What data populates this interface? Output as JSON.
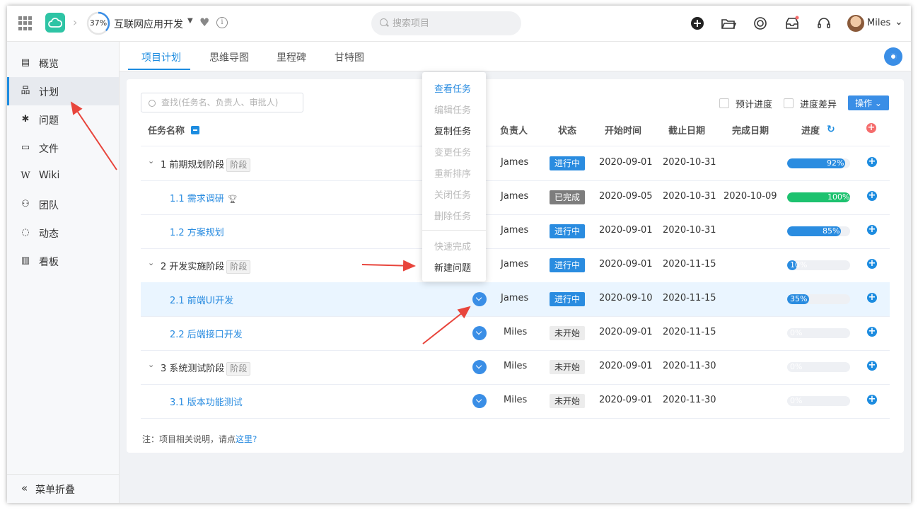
{
  "header": {
    "progress": "37%",
    "progress_value": 37,
    "project_title": "互联网应用开发",
    "search_placeholder": "搜索项目",
    "user_name": "Miles"
  },
  "sidebar": {
    "items": [
      {
        "label": "概览",
        "icon": "overview-icon"
      },
      {
        "label": "计划",
        "icon": "plan-icon"
      },
      {
        "label": "问题",
        "icon": "bug-icon"
      },
      {
        "label": "文件",
        "icon": "folder-icon"
      },
      {
        "label": "Wiki",
        "icon": "wiki-icon"
      },
      {
        "label": "团队",
        "icon": "team-icon"
      },
      {
        "label": "动态",
        "icon": "activity-icon"
      },
      {
        "label": "看板",
        "icon": "chart-icon"
      }
    ],
    "collapse_label": "菜单折叠"
  },
  "tabs": [
    "项目计划",
    "思维导图",
    "里程碑",
    "甘特图"
  ],
  "toolbar": {
    "search_placeholder": "查找(任务名、负责人、审批人)",
    "planned_progress": "预计进度",
    "progress_diff": "进度差异",
    "op_label": "操作 ⌄"
  },
  "table": {
    "headers": {
      "name": "任务名称",
      "owner": "负责人",
      "status": "状态",
      "start": "开始时间",
      "due": "截止日期",
      "done": "完成日期",
      "progress": "进度"
    },
    "stage_tag": "阶段",
    "rows": [
      {
        "name": "1 前期规划阶段",
        "stage": true,
        "owner": "James",
        "status": "进行中",
        "status_type": "doing",
        "start": "2020-09-01",
        "due": "2020-10-31",
        "done": "",
        "progress": 92,
        "progress_label": "92%"
      },
      {
        "name": "1.1 需求调研",
        "trophy": true,
        "owner": "James",
        "status": "已完成",
        "status_type": "done",
        "start": "2020-09-05",
        "due": "2020-10-31",
        "done": "2020-10-09",
        "progress": 100,
        "progress_label": "100%"
      },
      {
        "name": "1.2 方案规划",
        "owner": "James",
        "status": "进行中",
        "status_type": "doing",
        "start": "2020-09-01",
        "due": "2020-10-31",
        "done": "",
        "progress": 85,
        "progress_label": "85%"
      },
      {
        "name": "2 开发实施阶段",
        "stage": true,
        "owner": "James",
        "status": "进行中",
        "status_type": "doing",
        "start": "2020-09-01",
        "due": "2020-11-15",
        "done": "",
        "progress": 10,
        "progress_label": "10%"
      },
      {
        "name": "2.1 前端UI开发",
        "owner": "James",
        "status": "进行中",
        "status_type": "doing",
        "start": "2020-09-10",
        "due": "2020-11-15",
        "done": "",
        "progress": 35,
        "progress_label": "35%"
      },
      {
        "name": "2.2 后端接口开发",
        "owner": "Miles",
        "status": "未开始",
        "status_type": "todo",
        "start": "2020-09-01",
        "due": "2020-11-15",
        "done": "",
        "progress": 0,
        "progress_label": "0%"
      },
      {
        "name": "3 系统测试阶段",
        "stage": true,
        "owner": "Miles",
        "status": "未开始",
        "status_type": "todo",
        "start": "2020-09-01",
        "due": "2020-11-30",
        "done": "",
        "progress": 0,
        "progress_label": "0%"
      },
      {
        "name": "3.1 版本功能测试",
        "owner": "Miles",
        "status": "未开始",
        "status_type": "todo",
        "start": "2020-09-01",
        "due": "2020-11-30",
        "done": "",
        "progress": 0,
        "progress_label": "0%"
      }
    ]
  },
  "note": {
    "text": "注：项目相关说明，请点",
    "link": "这里?"
  },
  "menu": {
    "items": [
      {
        "label": "查看任务",
        "state": "active"
      },
      {
        "label": "编辑任务",
        "state": "disabled"
      },
      {
        "label": "复制任务",
        "state": "normal"
      },
      {
        "label": "变更任务",
        "state": "disabled"
      },
      {
        "label": "重新排序",
        "state": "disabled"
      },
      {
        "label": "关闭任务",
        "state": "disabled"
      },
      {
        "label": "删除任务",
        "state": "disabled"
      },
      {
        "label": "快速完成",
        "state": "disabled"
      },
      {
        "label": "新建问题",
        "state": "normal"
      }
    ]
  },
  "colors": {
    "accent": "#1d8ce0",
    "done_green": "#1dc26f",
    "annotation_red": "#e8453c"
  }
}
